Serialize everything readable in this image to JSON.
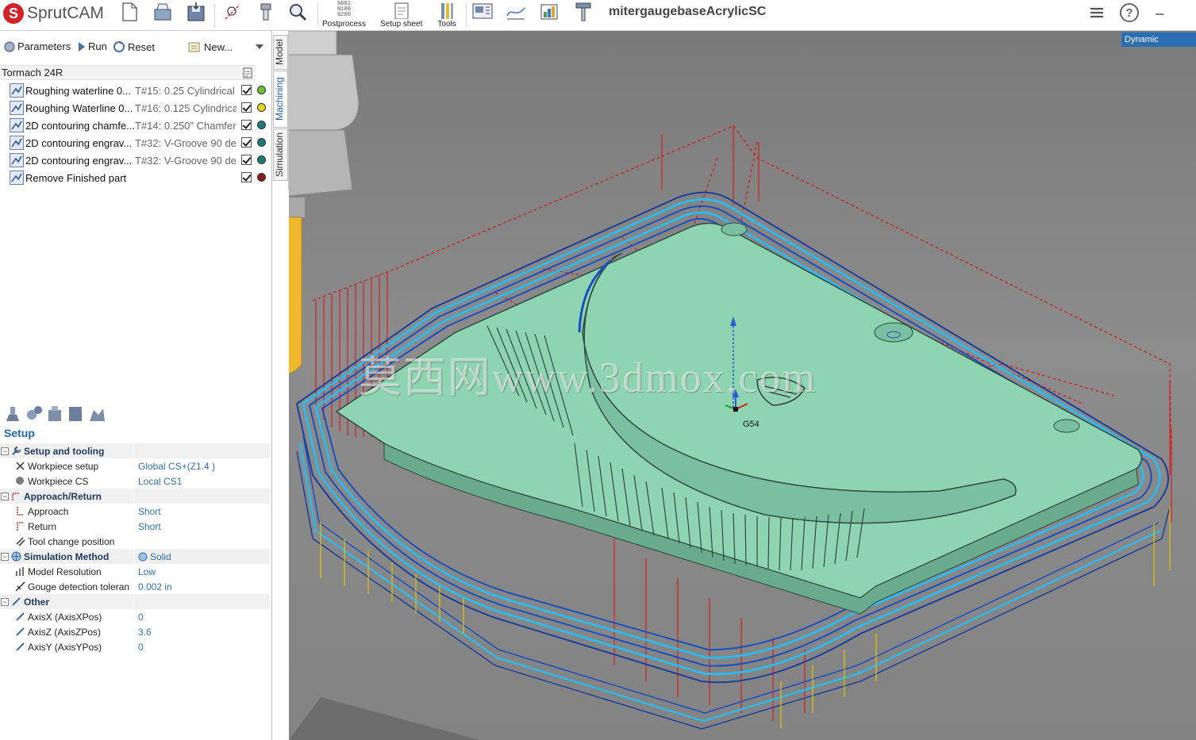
{
  "app": {
    "name": "SprutCAM",
    "document_title": "mitergaugebaseAcrylicSC"
  },
  "toolbar": {
    "postprocess_label": "Postprocess",
    "postprocess_glyph": "%001\nN100\nN200",
    "setup_sheet_label": "Setup sheet",
    "tools_label": "Tools"
  },
  "operations_toolbar": {
    "parameters_label": "Parameters",
    "run_label": "Run",
    "reset_label": "Reset",
    "new_label": "New..."
  },
  "machine": {
    "name": "Tormach 24R"
  },
  "side_tabs": {
    "model": "Model",
    "machining": "Machining",
    "simulation": "Simulation"
  },
  "operations": [
    {
      "name": "Roughing waterline 0...",
      "tool": "T#15: 0.25 Cylindrical",
      "status_color": "#6ac23a"
    },
    {
      "name": "Roughing Waterline 0...",
      "tool": "T#16: 0.125 Cylindrica",
      "status_color": "#e3d429"
    },
    {
      "name": "2D contouring chamfe...",
      "tool": "T#14: 0.250\" Chamfer",
      "status_color": "#1d7a78"
    },
    {
      "name": "2D contouring engrav...",
      "tool": "T#32: V-Groove 90 de",
      "status_color": "#1d7a78"
    },
    {
      "name": "2D contouring engrav...",
      "tool": "T#32: V-Groove 90 de",
      "status_color": "#1d7a78"
    },
    {
      "name": "Remove Finished part",
      "tool": "",
      "status_color": "#8b1a1a"
    }
  ],
  "setup": {
    "title": "Setup",
    "groups": {
      "setup_tooling": "Setup and tooling",
      "approach_return": "Approach/Return",
      "simulation_method": "Simulation Method",
      "other": "Other"
    },
    "simulation_method_value": "Solid",
    "rows": {
      "workpiece_setup": {
        "name": "Workpiece setup",
        "value": "Global CS+(Z1.4 )"
      },
      "workpiece_cs": {
        "name": "Workpiece CS",
        "value": "Local CS1"
      },
      "approach": {
        "name": "Approach",
        "value": "Short"
      },
      "return": {
        "name": "Return",
        "value": "Short"
      },
      "tool_change": {
        "name": "Tool change position",
        "value": ""
      },
      "model_resolution": {
        "name": "Model Resolution",
        "value": "Low"
      },
      "gouge": {
        "name": "Gouge detection toleran",
        "value": "0.002 in"
      },
      "axis_x": {
        "name": "AxisX (AxisXPos)",
        "value": "0"
      },
      "axis_z": {
        "name": "AxisZ (AxisZPos)",
        "value": "3.6"
      },
      "axis_y": {
        "name": "AxisY (AxisYPos)",
        "value": "0"
      }
    }
  },
  "viewport": {
    "view_mode": "Dynamic",
    "cs_label": "G54",
    "watermark": "莫西网www.3dmox.com"
  },
  "colors": {
    "accent": "#1a6aa8",
    "part_fill": "#8fd4b0",
    "toolpath_cyan": "#2fb8ea",
    "toolpath_blue": "#1a4fc0",
    "toolpath_red": "#d42020",
    "toolpath_yellow": "#e8c000",
    "tool_holder": "#c8c8c8",
    "tool_shank": "#f0b830"
  }
}
